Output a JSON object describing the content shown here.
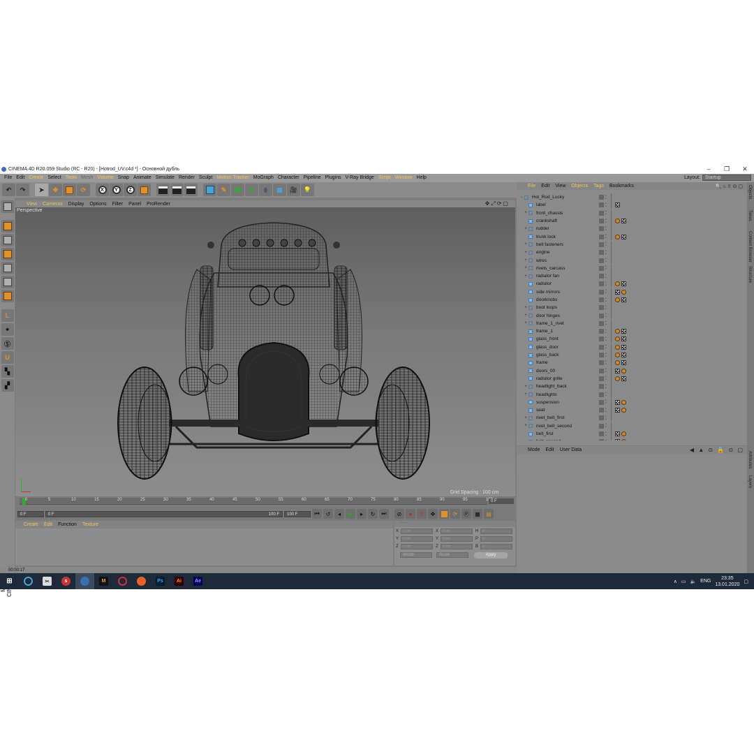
{
  "window": {
    "title": "CINEMA 4D R20.059 Studio (RC - R20) - [Hotrod_UV.c4d *] - Основной дубль",
    "minimize": "–",
    "maximize": "❐",
    "close": "✕"
  },
  "menubar": {
    "items": [
      "File",
      "Edit",
      "Create",
      "Select",
      "Tools",
      "Mesh",
      "Volume",
      "Snap",
      "Animate",
      "Simulate",
      "Render",
      "Sculpt",
      "Motion Tracker",
      "MoGraph",
      "Character",
      "Pipeline",
      "Plugins",
      "V-Ray Bridge",
      "Script",
      "Window",
      "Help"
    ],
    "layout_label": "Layout:",
    "layout_value": "Startup"
  },
  "viewport": {
    "menu": [
      "View",
      "Cameras",
      "Display",
      "Options",
      "Filter",
      "Panel",
      "ProRender"
    ],
    "label": "Perspective",
    "grid_spacing": "Grid Spacing : 100 cm"
  },
  "timeline": {
    "ticks": [
      "0",
      "5",
      "10",
      "15",
      "20",
      "25",
      "30",
      "35",
      "40",
      "45",
      "50",
      "55",
      "60",
      "65",
      "70",
      "75",
      "80",
      "85",
      "90",
      "95",
      "100"
    ],
    "end_field": "0 F"
  },
  "transport": {
    "start": "0 F",
    "min": "0 F",
    "max": "100 F",
    "end": "100 F"
  },
  "material": {
    "menu": [
      "Create",
      "Edit",
      "Function",
      "Texture"
    ]
  },
  "coordinates": {
    "header": "- - -",
    "rows": [
      {
        "a": "X",
        "av": "0 cm",
        "b": "X",
        "bv": "0 cm",
        "c": "H",
        "cv": "0 °"
      },
      {
        "a": "Y",
        "av": "0 cm",
        "b": "Y",
        "bv": "0 cm",
        "c": "P",
        "cv": "0 °"
      },
      {
        "a": "Z",
        "av": "0 cm",
        "b": "Z",
        "bv": "0 cm",
        "c": "B",
        "cv": "0 °"
      }
    ],
    "world": "World",
    "scale": "Scale",
    "apply": "Apply"
  },
  "status": {
    "time": "00:00:17"
  },
  "objects": {
    "menu": [
      "File",
      "Edit",
      "View",
      "Objects",
      "Tags",
      "Bookmarks"
    ],
    "items": [
      {
        "name": "Hot_Rod_Lucky",
        "exp": "−",
        "tags": []
      },
      {
        "name": "label",
        "exp": "",
        "tags": [
          "c"
        ]
      },
      {
        "name": "front_chassis",
        "exp": "+",
        "tags": []
      },
      {
        "name": "crankshaft",
        "exp": "",
        "tags": [
          "s",
          "c"
        ]
      },
      {
        "name": "rudder",
        "exp": "+",
        "tags": []
      },
      {
        "name": "trunk lock",
        "exp": "",
        "tags": [
          "s",
          "c"
        ]
      },
      {
        "name": "belt fasteners",
        "exp": "+",
        "tags": []
      },
      {
        "name": "engine",
        "exp": "+",
        "tags": []
      },
      {
        "name": "wires",
        "exp": "+",
        "tags": []
      },
      {
        "name": "rivets_carcass",
        "exp": "+",
        "tags": []
      },
      {
        "name": "radiator fan",
        "exp": "+",
        "tags": []
      },
      {
        "name": "radiator",
        "exp": "",
        "tags": [
          "s",
          "c"
        ]
      },
      {
        "name": "side mirrors",
        "exp": "",
        "tags": [
          "c",
          "s"
        ]
      },
      {
        "name": "doorknobs",
        "exp": "",
        "tags": [
          "s",
          "c"
        ]
      },
      {
        "name": "boot loops",
        "exp": "+",
        "tags": []
      },
      {
        "name": "door hinges",
        "exp": "+",
        "tags": []
      },
      {
        "name": "frame_1_rivet",
        "exp": "+",
        "tags": []
      },
      {
        "name": "frame_1",
        "exp": "",
        "tags": [
          "s",
          "c"
        ]
      },
      {
        "name": "glass_front",
        "exp": "",
        "tags": [
          "s",
          "c"
        ]
      },
      {
        "name": "glass_door",
        "exp": "",
        "tags": [
          "s",
          "c"
        ]
      },
      {
        "name": "glass_back",
        "exp": "",
        "tags": [
          "s",
          "c"
        ]
      },
      {
        "name": "frame",
        "exp": "",
        "tags": [
          "s",
          "c"
        ]
      },
      {
        "name": "doors_00",
        "exp": "",
        "tags": [
          "c",
          "s"
        ]
      },
      {
        "name": "radiator grille",
        "exp": "",
        "tags": [
          "s",
          "c"
        ]
      },
      {
        "name": "headlight_back",
        "exp": "+",
        "tags": []
      },
      {
        "name": "headlights",
        "exp": "+",
        "tags": []
      },
      {
        "name": "suspension",
        "exp": "",
        "tags": [
          "c",
          "s"
        ]
      },
      {
        "name": "seat",
        "exp": "",
        "tags": [
          "c",
          "s"
        ]
      },
      {
        "name": "rivet_belt_first",
        "exp": "+",
        "tags": []
      },
      {
        "name": "rivet_belt_second",
        "exp": "+",
        "tags": []
      },
      {
        "name": "belt_first",
        "exp": "",
        "tags": [
          "c",
          "s"
        ]
      },
      {
        "name": "belt_second",
        "exp": "",
        "tags": [
          "c",
          "s"
        ]
      }
    ]
  },
  "attributes": {
    "menu": [
      "Mode",
      "Edit",
      "User Data"
    ]
  },
  "right_tabs": [
    "Objects",
    "Takes",
    "Content Browser",
    "Structure",
    "Attributes",
    "Layers"
  ],
  "taskbar": {
    "lang": "ENG",
    "time": "23:35",
    "date": "13.01.2020"
  }
}
